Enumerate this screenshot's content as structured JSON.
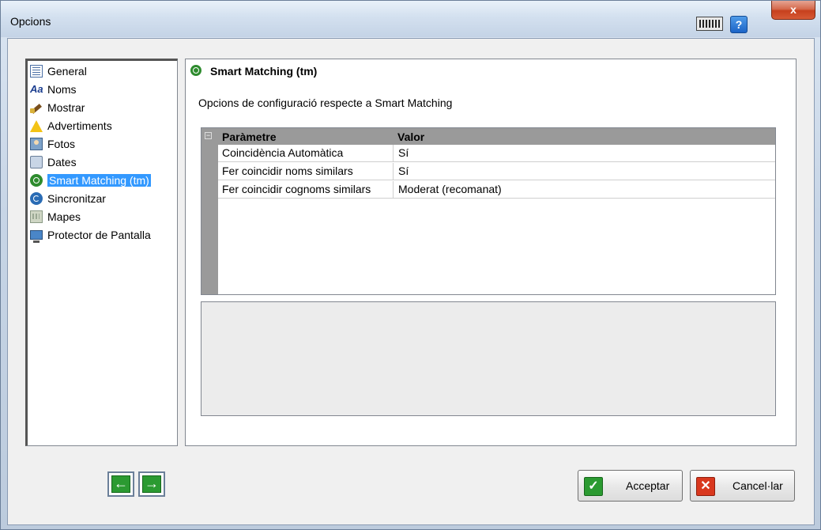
{
  "window": {
    "title": "Opcions",
    "close_label": "x",
    "help_label": "?"
  },
  "nav": {
    "items": [
      {
        "label": "General",
        "icon": "document-icon"
      },
      {
        "label": "Noms",
        "icon": "font-icon"
      },
      {
        "label": "Mostrar",
        "icon": "brush-icon"
      },
      {
        "label": "Advertiments",
        "icon": "warning-icon"
      },
      {
        "label": "Fotos",
        "icon": "photo-icon"
      },
      {
        "label": "Dates",
        "icon": "calendar-icon"
      },
      {
        "label": "Smart Matching (tm)",
        "icon": "smart-matching-icon",
        "selected": true
      },
      {
        "label": "Sincronitzar",
        "icon": "sync-icon"
      },
      {
        "label": "Mapes",
        "icon": "map-icon"
      },
      {
        "label": "Protector de Pantalla",
        "icon": "screensaver-icon"
      }
    ]
  },
  "panel": {
    "title": "Smart Matching (tm)",
    "description": "Opcions de configuració respecte a Smart Matching",
    "grid": {
      "collapse_symbol": "−",
      "columns": [
        "Paràmetre",
        "Valor"
      ],
      "rows": [
        [
          "Coincidència Automàtica",
          "Sí"
        ],
        [
          "Fer coincidir noms similars",
          "Sí"
        ],
        [
          "Fer coincidir cognoms similars",
          "Moderat (recomanat)"
        ]
      ]
    }
  },
  "buttons": {
    "back_symbol": "←",
    "forward_symbol": "→",
    "accept_label": "Acceptar",
    "accept_symbol": "✓",
    "cancel_label": "Cancel·lar",
    "cancel_symbol": "✕"
  },
  "colors": {
    "selection": "#3399ff",
    "accept_green": "#2b9a31",
    "cancel_red": "#d9381e"
  }
}
